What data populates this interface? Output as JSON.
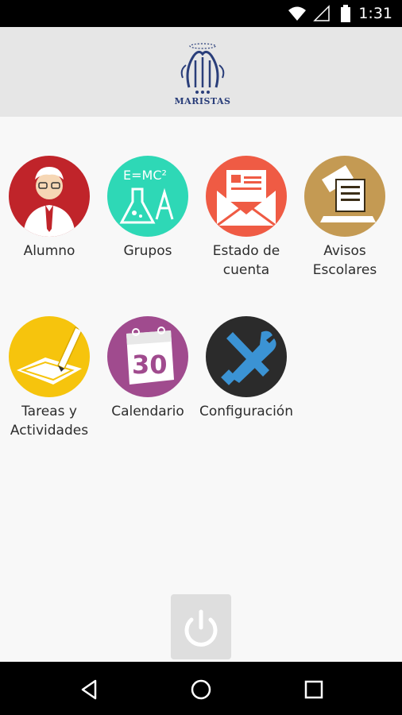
{
  "status_bar": {
    "time": "1:31",
    "icons": [
      "wifi-icon",
      "cellular-signal-icon",
      "battery-icon"
    ]
  },
  "header": {
    "logo_text": "MARISTAS"
  },
  "menu": {
    "items": [
      {
        "label": "Alumno",
        "icon": "student-icon",
        "color": "#c0242a"
      },
      {
        "label": "Grupos",
        "icon": "science-icon",
        "color": "#2ed8b6"
      },
      {
        "label": "Estado de cuenta",
        "icon": "envelope-icon",
        "color": "#ef5b44"
      },
      {
        "label": "Avisos Escolares",
        "icon": "notice-icon",
        "color": "#c49a53"
      },
      {
        "label": "Tareas y Actividades",
        "icon": "pencil-icon",
        "color": "#f6c40d"
      },
      {
        "label": "Calendario",
        "icon": "calendar-icon",
        "color": "#a04b8e",
        "number": "30"
      },
      {
        "label": "Configuración",
        "icon": "tools-icon",
        "color": "#2b2b2b"
      }
    ]
  },
  "power_button": {
    "icon": "power-icon"
  },
  "nav_bar": {
    "buttons": [
      "back-icon",
      "home-icon",
      "recents-icon"
    ]
  }
}
